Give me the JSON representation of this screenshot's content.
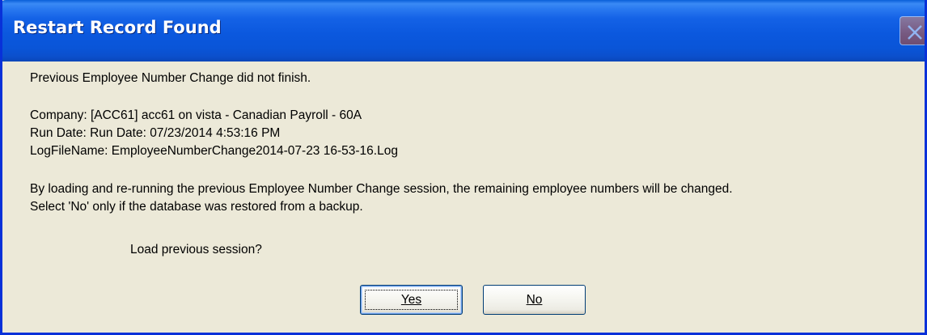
{
  "window": {
    "title": "Restart Record Found"
  },
  "message": {
    "intro": "Previous Employee Number Change did not finish.",
    "company": "Company:  [ACC61] acc61 on vista - Canadian Payroll - 60A",
    "run_date": "Run Date: Run Date: 07/23/2014  4:53:16 PM",
    "log_file": "LogFileName: EmployeeNumberChange2014-07-23 16-53-16.Log",
    "explanation_line1": "By loading and re-running the previous Employee Number Change session, the remaining employee numbers will be changed.",
    "explanation_line2": "Select 'No' only if the database was restored from a backup.",
    "question": "Load previous session?"
  },
  "buttons": {
    "yes_label": "Yes",
    "no_label": "No"
  },
  "colors": {
    "titlebar": "#0b58de",
    "window_background": "#ece9d8",
    "frame_border": "#0831d9"
  },
  "icons": {
    "close": "close-icon"
  }
}
